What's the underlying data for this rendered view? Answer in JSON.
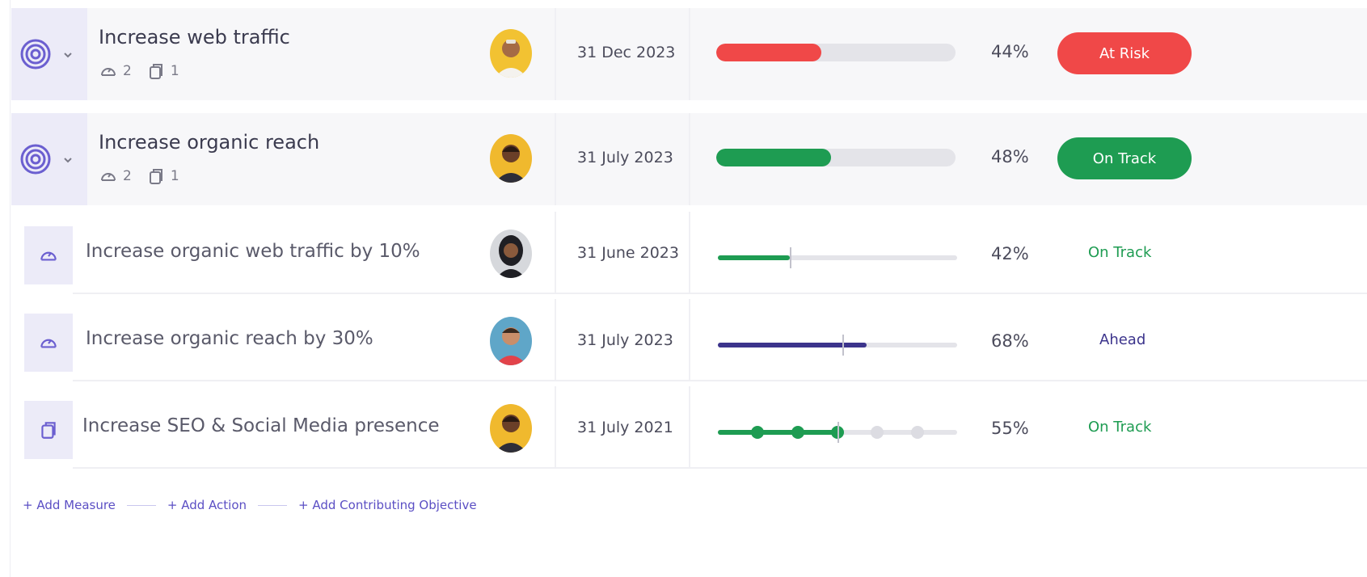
{
  "colors": {
    "at_risk": "#f04848",
    "on_track": "#1e9c52",
    "ahead": "#3c348c",
    "track_bg": "#e4e4e9",
    "link": "#5b4fc4",
    "icon_accent": "#6b5fd0"
  },
  "objectives": [
    {
      "title": "Increase web traffic",
      "icon": "target-icon",
      "measure_count": "2",
      "action_count": "1",
      "date": "31 Dec 2023",
      "progress_percent": 44,
      "progress_label": "44%",
      "status": "At Risk",
      "status_color": "#f04848"
    },
    {
      "title": "Increase organic reach",
      "icon": "target-icon",
      "measure_count": "2",
      "action_count": "1",
      "date": "31 July 2023",
      "progress_percent": 48,
      "progress_label": "48%",
      "status": "On Track",
      "status_color": "#1e9c52"
    }
  ],
  "measures": [
    {
      "title": "Increase organic web traffic by 10%",
      "icon": "gauge-icon",
      "date": "31 June 2023",
      "progress_percent": 30,
      "target_percent": 30,
      "progress_label": "42%",
      "status": "On Track",
      "status_color": "#1e9c52"
    },
    {
      "title": "Increase organic reach by 30%",
      "icon": "gauge-icon",
      "date": "31 July 2023",
      "progress_percent": 62,
      "target_percent": 52,
      "progress_label": "68%",
      "status": "Ahead",
      "status_color": "#3c348c"
    },
    {
      "title": "Increase SEO & Social Media presence",
      "icon": "action-icon",
      "date": "31 July 2021",
      "progress_label": "55%",
      "milestones_done": 3,
      "milestones_total": 5,
      "status": "On Track",
      "status_color": "#1e9c52"
    }
  ],
  "footer": {
    "add_measure": "+ Add Measure",
    "add_action": "+ Add Action",
    "add_objective": "+ Add Contributing Objective"
  }
}
